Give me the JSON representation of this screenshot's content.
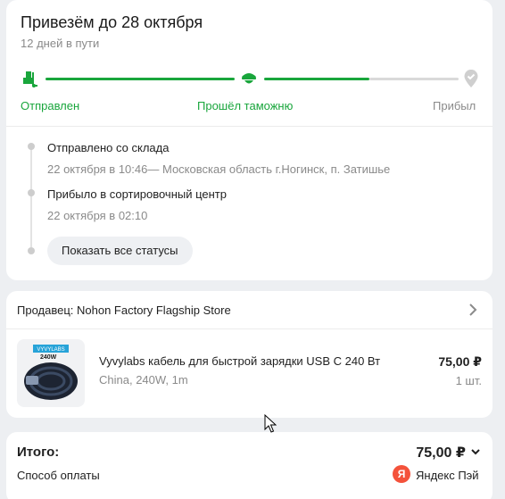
{
  "delivery": {
    "title": "Привезём до 28 октября",
    "subtitle": "12 дней в пути",
    "progress_fraction": 0.75,
    "steps": [
      {
        "label": "Отправлен",
        "state": "done",
        "icon": "dolly-icon"
      },
      {
        "label": "Прошёл таможню",
        "state": "done",
        "icon": "customs-officer-icon"
      },
      {
        "label": "Прибыл",
        "state": "pending",
        "icon": "location-pin-icon"
      }
    ]
  },
  "timeline": [
    {
      "title": "Отправлено со склада",
      "detail": "22 октября в 10:46— Московская область г.Ногинск, п. Затишье"
    },
    {
      "title": "Прибыло в сортировочный центр",
      "detail": "22 октября в 02:10"
    }
  ],
  "show_all_label": "Показать все статусы",
  "seller": {
    "label": "Продавец: Nohon Factory Flagship Store"
  },
  "product": {
    "name": "Vyvylabs кабель для быстрой зарядки USB C 240 Вт",
    "variant": "China, 240W, 1m",
    "price": "75,00 ₽",
    "qty": "1 шт.",
    "image_badge": "240W",
    "image_brand": "VYVYLABS"
  },
  "total": {
    "label": "Итого:",
    "value": "75,00 ₽",
    "payment_label": "Способ оплаты",
    "payment_logo": "Я",
    "payment_value": "Яндекс Пэй"
  },
  "colors": {
    "accent": "#19a63c",
    "pending": "#d9d9d9",
    "brand_ya": "#f4523b"
  }
}
